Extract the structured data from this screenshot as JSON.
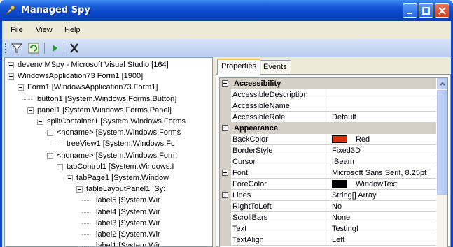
{
  "window": {
    "title": "Managed Spy"
  },
  "menu": [
    "File",
    "View",
    "Help"
  ],
  "toolbar": {
    "icons": [
      "filter-icon",
      "refresh-icon",
      "play-icon",
      "delete-icon"
    ]
  },
  "tree": [
    {
      "text": "devenv  MSpy - Microsoft Visual Studio [164]",
      "expander": "plus"
    },
    {
      "text": "WindowsApplication73  Form1 [1900]",
      "expander": "minus"
    },
    {
      "text": "Form1    [WindowsApplication73.Form1]",
      "expander": "minus"
    },
    {
      "text": "button1    [System.Windows.Forms.Button]",
      "expander": "none"
    },
    {
      "text": "panel1    [System.Windows.Forms.Panel]",
      "expander": "minus"
    },
    {
      "text": "splitContainer1    [System.Windows.Forms",
      "expander": "minus"
    },
    {
      "text": "<noname>    [System.Windows.Forms",
      "expander": "minus"
    },
    {
      "text": "treeView1    [System.Windows.Fc",
      "expander": "none"
    },
    {
      "text": "<noname>    [System.Windows.Form",
      "expander": "minus"
    },
    {
      "text": "tabControl1    [System.Windows.I",
      "expander": "minus"
    },
    {
      "text": "tabPage1    [System.Window",
      "expander": "minus"
    },
    {
      "text": "tableLayoutPanel1    [Sy:",
      "expander": "minus"
    },
    {
      "text": "label5    [System.Wir",
      "expander": "none"
    },
    {
      "text": "label4    [System.Wir",
      "expander": "none"
    },
    {
      "text": "label3    [System.Wir",
      "expander": "none"
    },
    {
      "text": "label2    [System.Wir",
      "expander": "none"
    },
    {
      "text": "label1    [System.Wir",
      "expander": "none"
    }
  ],
  "tabs": {
    "properties": "Properties",
    "events": "Events"
  },
  "grid": [
    {
      "kind": "category",
      "name": "Accessibility"
    },
    {
      "kind": "prop",
      "name": "AccessibleDescription",
      "value": ""
    },
    {
      "kind": "prop",
      "name": "AccessibleName",
      "value": ""
    },
    {
      "kind": "prop",
      "name": "AccessibleRole",
      "value": "Default"
    },
    {
      "kind": "category",
      "name": "Appearance"
    },
    {
      "kind": "prop",
      "name": "BackColor",
      "value": "Red",
      "swatch": "#d4310c"
    },
    {
      "kind": "prop",
      "name": "BorderStyle",
      "value": "Fixed3D"
    },
    {
      "kind": "prop",
      "name": "Cursor",
      "value": "IBeam"
    },
    {
      "kind": "prop",
      "name": "Font",
      "value": "Microsoft Sans Serif, 8.25pt",
      "expander": "plus"
    },
    {
      "kind": "prop",
      "name": "ForeColor",
      "value": "WindowText",
      "swatch": "#000000"
    },
    {
      "kind": "prop",
      "name": "Lines",
      "value": "String[] Array",
      "expander": "plus"
    },
    {
      "kind": "prop",
      "name": "RightToLeft",
      "value": "No"
    },
    {
      "kind": "prop",
      "name": "ScrollBars",
      "value": "None"
    },
    {
      "kind": "prop",
      "name": "Text",
      "value": "Testing!"
    },
    {
      "kind": "prop",
      "name": "TextAlign",
      "value": "Left"
    }
  ]
}
